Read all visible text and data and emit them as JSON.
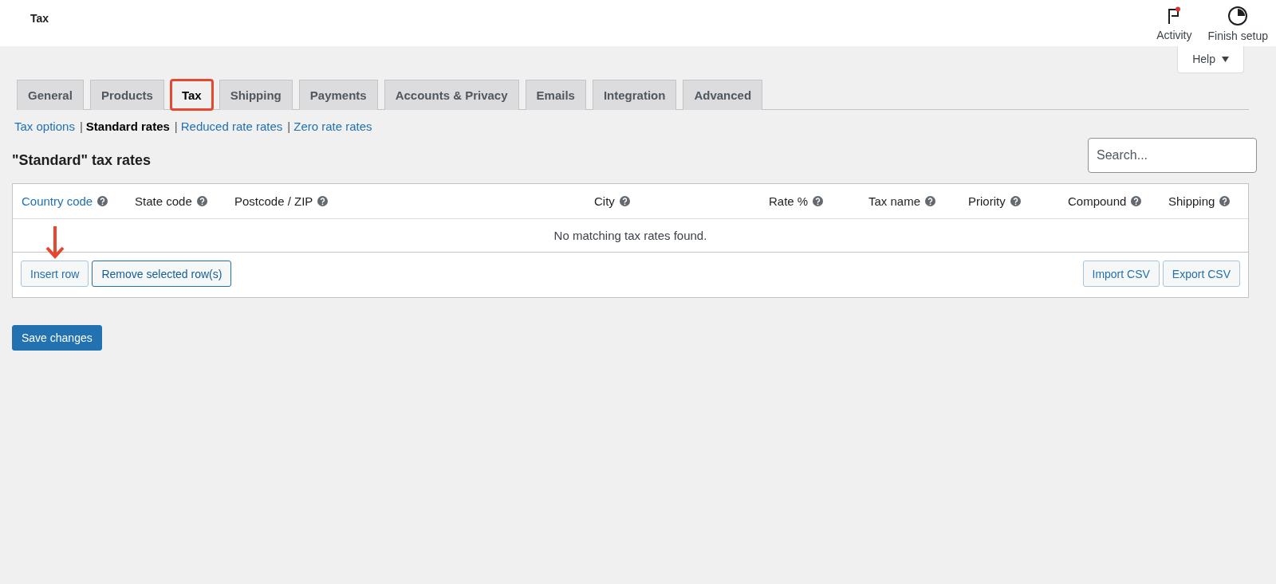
{
  "header": {
    "title": "Tax",
    "actions": [
      {
        "kind": "activity",
        "label": "Activity",
        "notification": true
      },
      {
        "kind": "setup",
        "label": "Finish setup"
      }
    ]
  },
  "help": {
    "label": "Help"
  },
  "tabs": [
    {
      "label": "General",
      "selected": false
    },
    {
      "label": "Products",
      "selected": false
    },
    {
      "label": "Tax",
      "selected": true,
      "highlighted": true
    },
    {
      "label": "Shipping",
      "selected": false
    },
    {
      "label": "Payments",
      "selected": false
    },
    {
      "label": "Accounts & Privacy",
      "selected": false
    },
    {
      "label": "Emails",
      "selected": false
    },
    {
      "label": "Integration",
      "selected": false
    },
    {
      "label": "Advanced",
      "selected": false
    }
  ],
  "subnav": [
    {
      "label": "Tax options",
      "selected": false
    },
    {
      "separator": "|",
      "label": "Standard rates",
      "selected": true
    },
    {
      "separator": "|",
      "label": "Reduced rate rates",
      "selected": false
    },
    {
      "separator": "|",
      "label": "Zero rate rates",
      "selected": false
    }
  ],
  "heading": "\"Standard\" tax rates",
  "search": {
    "placeholder": "Search..."
  },
  "table": {
    "columns": [
      {
        "label": "Country code",
        "kind": "link"
      },
      {
        "label": "State code",
        "kind": "text"
      },
      {
        "label": "Postcode / ZIP",
        "kind": "text"
      },
      {
        "label": "City",
        "kind": "text"
      },
      {
        "label": "Rate %",
        "kind": "text"
      },
      {
        "label": "Tax name",
        "kind": "text"
      },
      {
        "label": "Priority",
        "kind": "text"
      },
      {
        "label": "Compound",
        "kind": "text"
      },
      {
        "label": "Shipping",
        "kind": "text"
      }
    ],
    "empty_message": "No matching tax rates found.",
    "left_buttons": [
      "Insert row",
      "Remove selected row(s)"
    ],
    "annotations": [
      {
        "kind": "arrow"
      }
    ],
    "right_buttons": [
      "Import CSV",
      "Export CSV"
    ]
  },
  "save_button": "Save changes"
}
